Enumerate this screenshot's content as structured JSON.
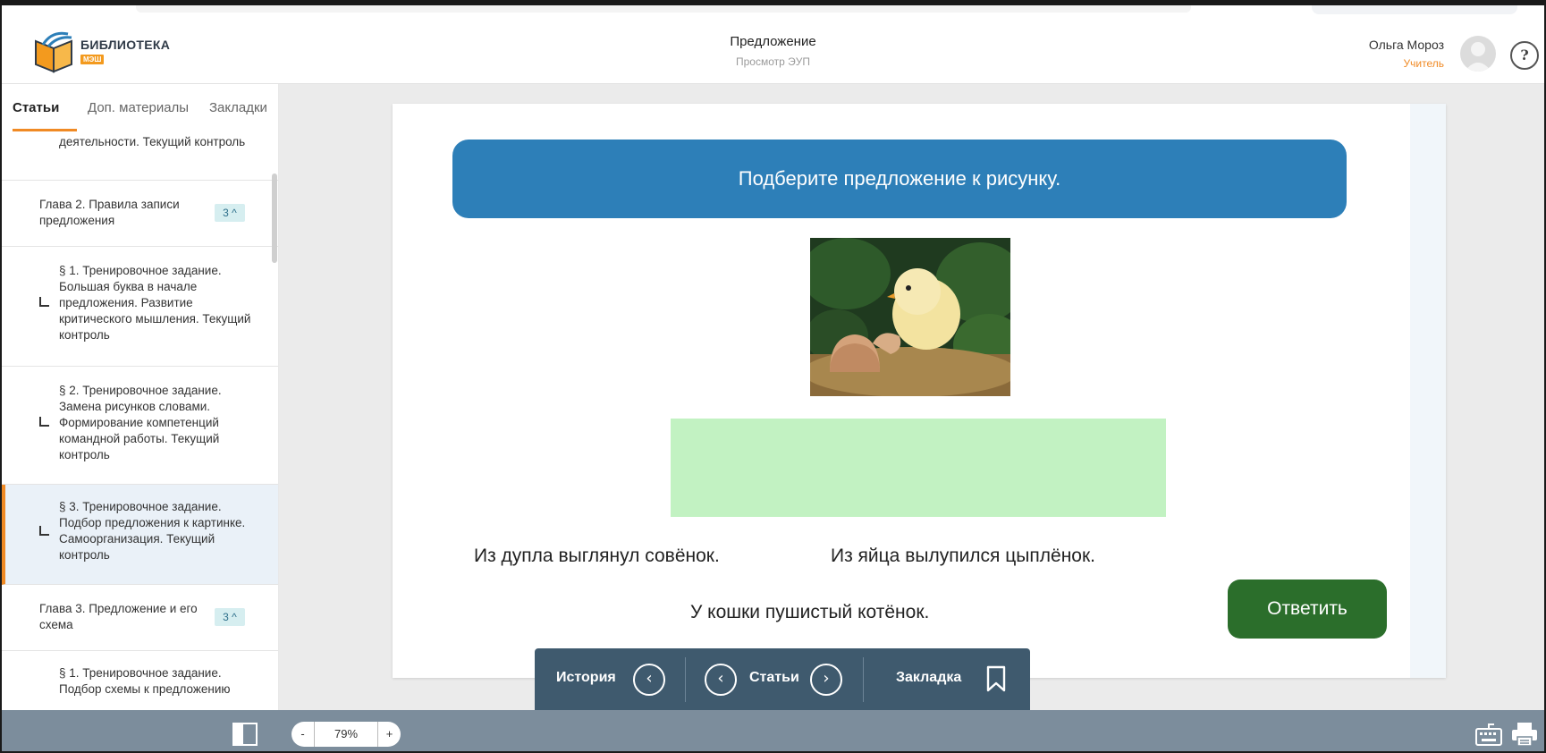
{
  "header": {
    "logo_title": "БИБЛИОТЕКА",
    "logo_badge": "МЭШ",
    "title": "Предложение",
    "subtitle": "Просмотр ЭУП",
    "user_name": "Ольга Мороз",
    "user_role": "Учитель",
    "help_label": "?"
  },
  "sidebar": {
    "tabs": [
      "Статьи",
      "Доп. материалы",
      "Закладки"
    ],
    "items": [
      {
        "kind": "section",
        "text": "деятельности. Текущий контроль",
        "marker": false,
        "active": false
      },
      {
        "kind": "chapter",
        "text": "Глава 2. Правила записи предложения",
        "count": "3 ^"
      },
      {
        "kind": "section",
        "text": "§ 1. Тренировочное задание. Большая буква в начале предложения. Развитие критического мышления. Текущий контроль",
        "marker": true,
        "active": false
      },
      {
        "kind": "section",
        "text": "§ 2. Тренировочное задание. Замена рисунков словами. Формирование компетенций командной работы. Текущий контроль",
        "marker": true,
        "active": false
      },
      {
        "kind": "section",
        "text": "§ 3. Тренировочное задание. Подбор предложения к картинке. Самоорганизация. Текущий контроль",
        "marker": true,
        "active": true
      },
      {
        "kind": "chapter",
        "text": "Глава 3. Предложение и его схема",
        "count": "3 ^"
      },
      {
        "kind": "section",
        "text": "§ 1. Тренировочное задание. Подбор схемы к предложению",
        "marker": false,
        "active": false
      }
    ]
  },
  "task": {
    "prompt": "Подберите предложение к рисунку.",
    "options": [
      "Из дупла выглянул совёнок.",
      "Из яйца вылупился цыплёнок.",
      "У кошки пушистый котёнок."
    ],
    "answer_label": "Ответить"
  },
  "nav": {
    "history_label": "История",
    "articles_label": "Статьи",
    "bookmark_label": "Закладка"
  },
  "bottom": {
    "zoom_minus": "-",
    "zoom_value": "79%",
    "zoom_plus": "+"
  },
  "colors": {
    "accent": "#f08a24",
    "banner": "#2d7fb8",
    "answer_button": "#2b6e2b",
    "dropzone": "#c2f2c2",
    "navbar": "#3f5a6e",
    "bottombar": "#7c8d9c"
  }
}
